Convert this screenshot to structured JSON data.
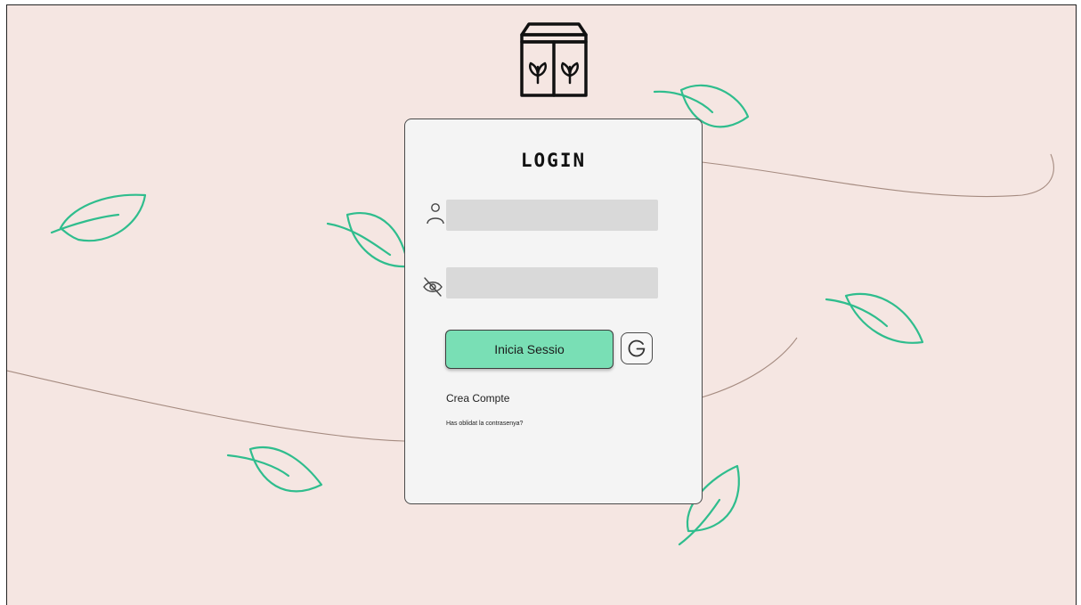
{
  "login": {
    "title": "LOGIN",
    "username": {
      "value": "",
      "placeholder": ""
    },
    "password": {
      "value": "",
      "placeholder": ""
    },
    "submit_label": "Inicia Sessio",
    "google_label": "G",
    "create_account_label": "Crea Compte",
    "forgot_password_label": "Has oblidat la contrasenya?"
  },
  "icons": {
    "logo": "plant-shop-logo-icon",
    "username": "user-icon",
    "password": "eye-off-icon",
    "google": "google-icon",
    "decoration": "leaf-icon"
  },
  "colors": {
    "background": "#f5e6e2",
    "card": "#f4f4f4",
    "input": "#d9d9d9",
    "primary_button": "#79dfb5",
    "leaf": "#2fbd8d",
    "vine": "#a58b80"
  }
}
